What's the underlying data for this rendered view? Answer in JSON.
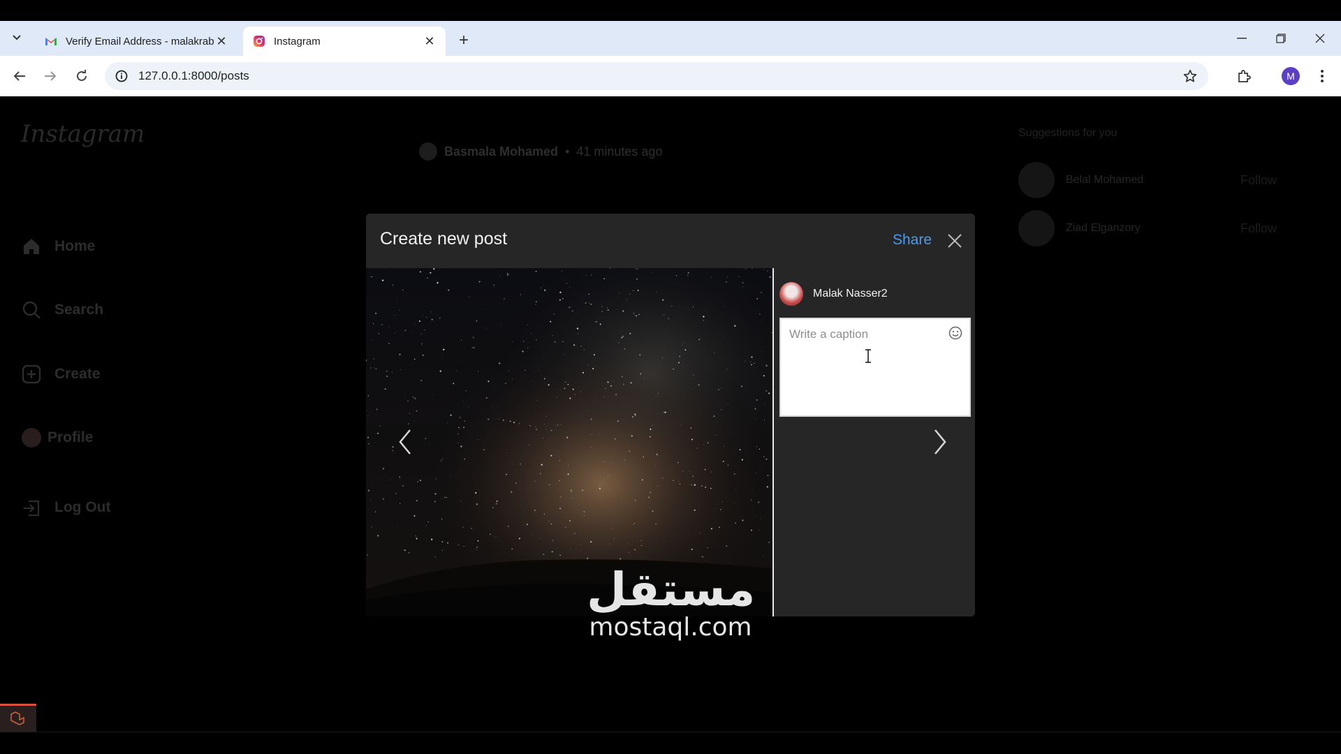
{
  "browser": {
    "tabs": [
      {
        "title": "Verify Email Address - malakrab",
        "favicon": "gmail-icon",
        "active": false
      },
      {
        "title": "Instagram",
        "favicon": "instagram-icon",
        "active": true
      }
    ],
    "url": "127.0.0.1:8000/posts",
    "profile_initial": "M"
  },
  "sidebar": {
    "logo": "Instagram",
    "items": [
      {
        "label": "Home",
        "icon": "home-icon"
      },
      {
        "label": "Search",
        "icon": "search-icon"
      },
      {
        "label": "Create",
        "icon": "create-icon"
      },
      {
        "label": "Profile",
        "icon": "avatar"
      },
      {
        "label": "Log Out",
        "icon": "logout-icon"
      }
    ]
  },
  "feed": {
    "post_author": "Basmala Mohamed",
    "post_time": "41 minutes ago"
  },
  "suggestions": {
    "title": "Suggestions for you",
    "users": [
      {
        "name": "Belal Mohamed",
        "action": "Follow"
      },
      {
        "name": "Ziad Elganzory",
        "action": "Follow"
      }
    ]
  },
  "modal": {
    "title": "Create new post",
    "share_label": "Share",
    "author_name": "Malak Nasser2",
    "caption_placeholder": "Write a caption",
    "caption_value": ""
  },
  "watermark": {
    "arabic": "مستقل",
    "latin": "mostaql.com"
  },
  "colors": {
    "share_blue": "#4a9cf0",
    "modal_bg": "#262626",
    "tabstrip_bg": "#dfe9f8"
  }
}
